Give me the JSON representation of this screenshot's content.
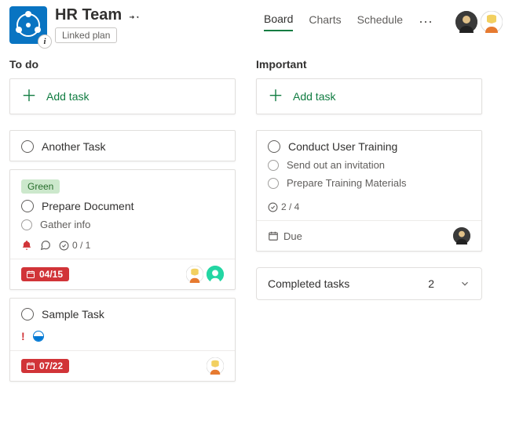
{
  "header": {
    "title": "HR Team",
    "linked_label": "Linked plan",
    "tabs": [
      "Board",
      "Charts",
      "Schedule"
    ],
    "active_tab": 0,
    "info_glyph": "i"
  },
  "columns": [
    {
      "title": "To do",
      "add_label": "Add task"
    },
    {
      "title": "Important",
      "add_label": "Add task"
    }
  ],
  "col0": {
    "task0": {
      "title": "Another Task"
    },
    "task1": {
      "label": "Green",
      "title": "Prepare Document",
      "sub0": "Gather info",
      "progress": "0 / 1",
      "due": "04/15"
    },
    "task2": {
      "title": "Sample Task",
      "due": "07/22"
    }
  },
  "col1": {
    "task0": {
      "title": "Conduct User Training",
      "sub0": "Send out an invitation",
      "sub1": "Prepare Training Materials",
      "progress": "2 / 4",
      "due_label": "Due"
    },
    "completed_label": "Completed tasks",
    "completed_count": "2"
  }
}
